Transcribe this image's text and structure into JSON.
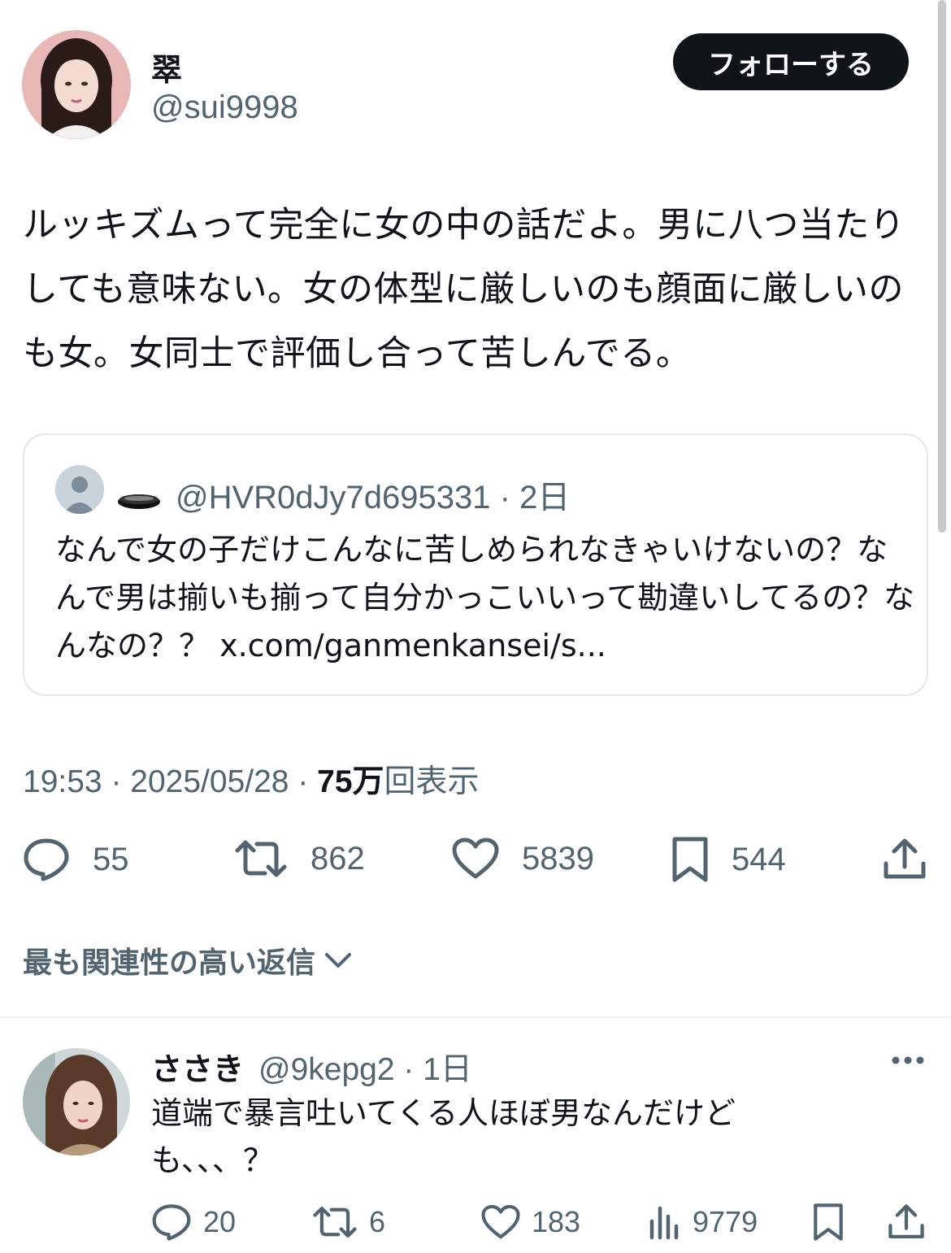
{
  "tweet": {
    "author_name": "翠",
    "author_handle": "@sui9998",
    "follow_label": "フォローする",
    "text": "ルッキズムって完全に女の中の話だよ。男に八つ当たりしても意味ない。女の体型に厳しいのも顔面に厳しいのも女。女同士で評価し合って苦しんでる。",
    "quote": {
      "handle": "@HVR0dJy7d695331",
      "time": "2日",
      "text": "なんで女の子だけこんなに苦しめられなきゃいけないの？なんで男は揃いも揃って自分かっこいいって勘違いしてるの？なんなの？？ x.com/ganmenkansei/s..."
    },
    "time": "19:53",
    "date": "2025/05/28",
    "views_count": "75万",
    "views_label": "回表示",
    "replies": "55",
    "retweets": "862",
    "likes": "5839",
    "bookmarks": "544"
  },
  "sort_label": "最も関連性の高い返信",
  "reply": {
    "author_name": "ささき",
    "author_handle": "@9kepg2",
    "time": "1日",
    "text": "道端で暴言吐いてくる人ほぼ男なんだけども、、、？",
    "replies": "20",
    "retweets": "6",
    "likes": "183",
    "views": "9779"
  },
  "icons": {
    "reply": "reply-icon",
    "retweet": "retweet-icon",
    "like": "heart-icon",
    "bookmark": "bookmark-icon",
    "share": "share-icon",
    "views": "views-icon",
    "more": "more-icon",
    "chevron": "chevron-down-icon"
  },
  "colors": {
    "text": "#0f1419",
    "secondary": "#536471",
    "border": "#e1e8ed",
    "button": "#0f1419"
  }
}
